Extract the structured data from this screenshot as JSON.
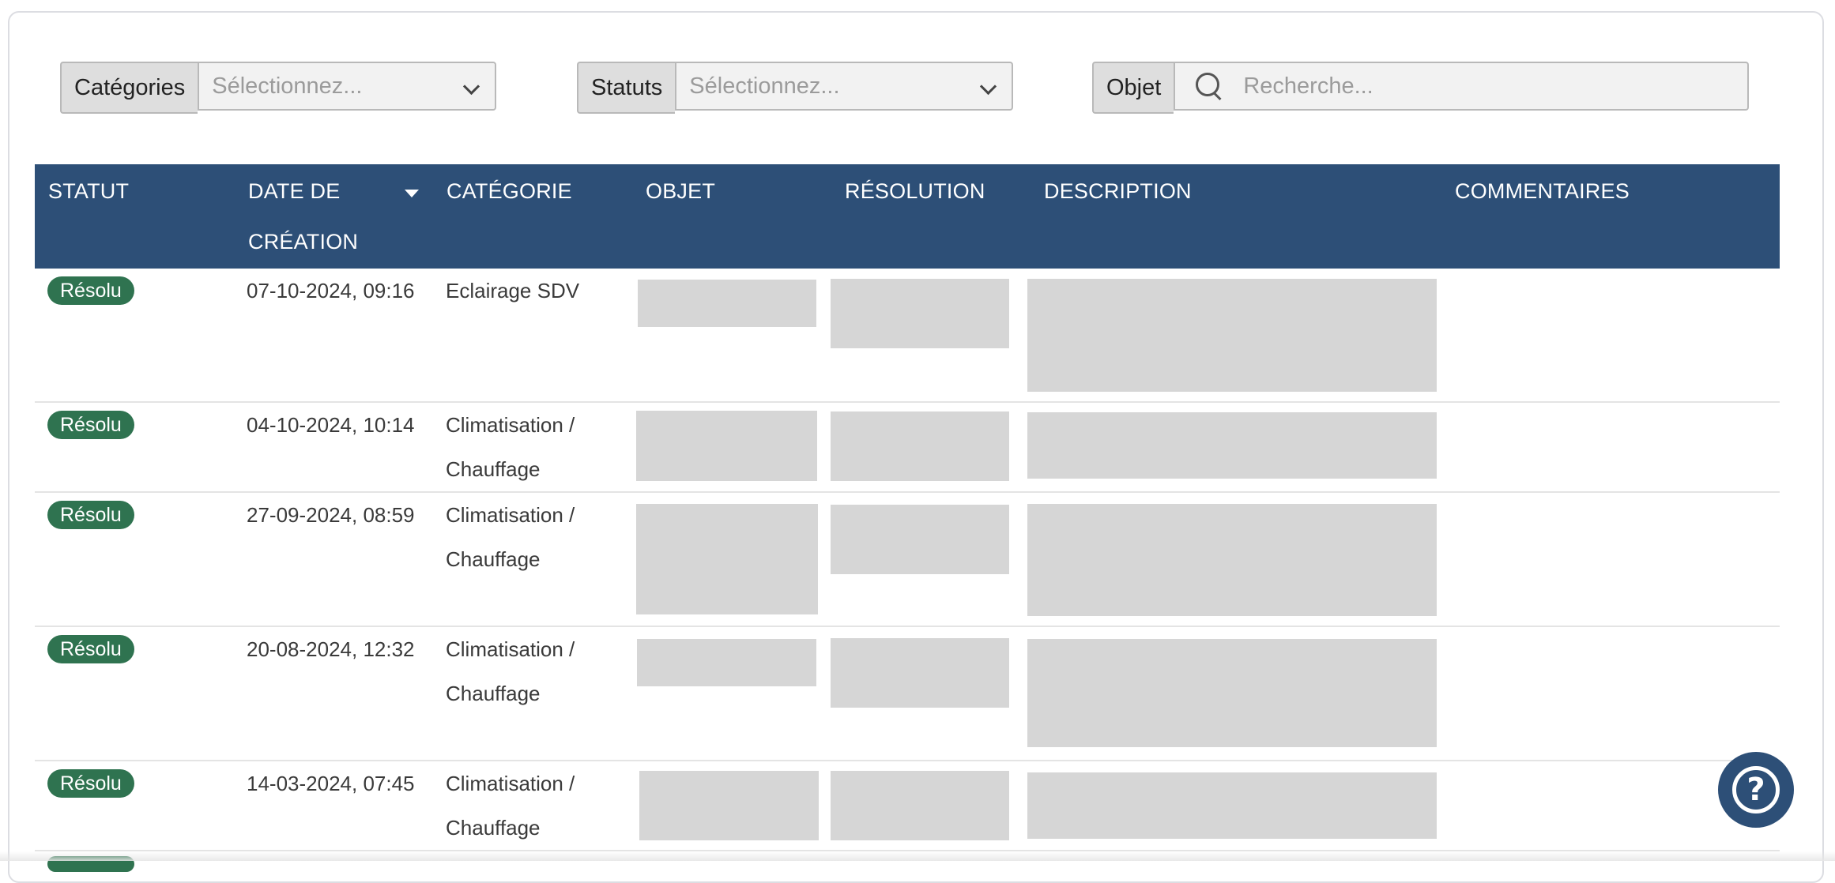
{
  "filters": {
    "categories": {
      "label": "Catégories",
      "placeholder": "Sélectionnez..."
    },
    "statuses": {
      "label": "Statuts",
      "placeholder": "Sélectionnez..."
    },
    "object": {
      "label": "Objet",
      "placeholder": "Recherche..."
    }
  },
  "table": {
    "headers": {
      "status": "STATUT",
      "date_line1": "DATE DE",
      "date_line2": "CRÉATION",
      "category": "CATÉGORIE",
      "object": "OBJET",
      "resolution": "RÉSOLUTION",
      "description": "DESCRIPTION",
      "comments": "COMMENTAIRES"
    },
    "rows": [
      {
        "status": "Résolu",
        "date": "07-10-2024, 09:16",
        "category_line1": "Eclairage SDV",
        "category_line2": ""
      },
      {
        "status": "Résolu",
        "date": "04-10-2024, 10:14",
        "category_line1": "Climatisation /",
        "category_line2": "Chauffage"
      },
      {
        "status": "Résolu",
        "date": "27-09-2024, 08:59",
        "category_line1": "Climatisation /",
        "category_line2": "Chauffage"
      },
      {
        "status": "Résolu",
        "date": "20-08-2024, 12:32",
        "category_line1": "Climatisation /",
        "category_line2": "Chauffage"
      },
      {
        "status": "Résolu",
        "date": "14-03-2024, 07:45",
        "category_line1": "Climatisation /",
        "category_line2": "Chauffage"
      }
    ]
  },
  "colors": {
    "header_bg": "#2d4f77",
    "badge_bg": "#2f7350",
    "placeholder_block": "#d6d6d6"
  },
  "icons": {
    "search": "search-icon",
    "help": "help-icon",
    "chevron": "chevron-down-icon",
    "sort": "sort-desc-icon"
  }
}
